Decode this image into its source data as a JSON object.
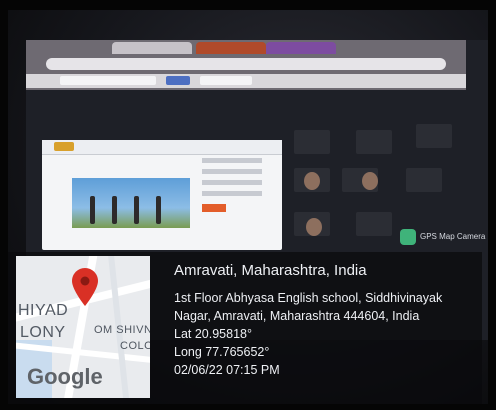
{
  "location_stamp": {
    "city_line": "Amravati, Maharashtra, India",
    "address_line_1": "1st Floor Abhyasa English school, Siddhivinayak",
    "address_line_2": "Nagar, Amravati, Maharashtra 444604, India",
    "latitude": "Lat 20.95818°",
    "longitude": "Long 77.765652°",
    "datetime": "02/06/22 07:15 PM"
  },
  "map_thumbnail": {
    "label_1": "HIYAD",
    "label_2": "LONY",
    "label_3": "OM SHIVN",
    "label_4": "COLO",
    "brand": "Google",
    "pin_color": "#d93025"
  },
  "screen_app": {
    "camera_app_label": "GPS Map Camera"
  },
  "colors": {
    "overlay_bg": "#0a0a0c",
    "stamp_text": "#eef0f4"
  }
}
